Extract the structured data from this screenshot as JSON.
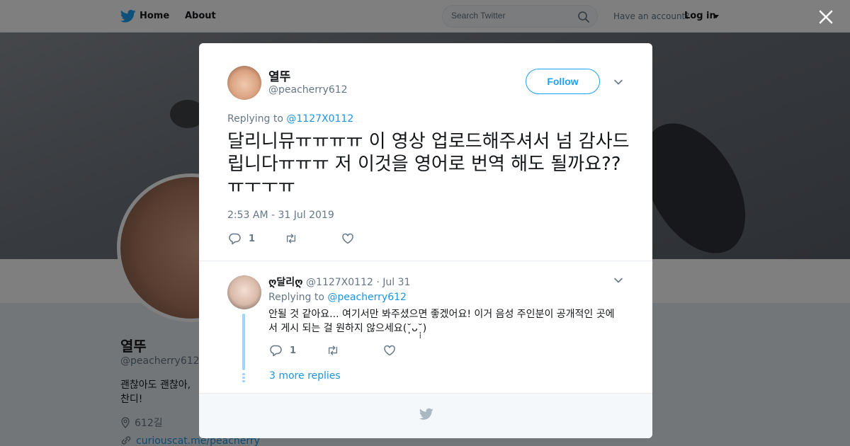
{
  "nav": {
    "home_label": "Home",
    "about_label": "About",
    "search_placeholder": "Search Twitter",
    "account_text": "Have an account?",
    "login_label": "Log in"
  },
  "profile": {
    "name": "열뚜",
    "handle": "@peacherry612",
    "bio": "괜찮아도 괜찮아, 찬디!",
    "location": "612길",
    "url": "curiouscat.me/peacherry"
  },
  "tweet": {
    "name": "열뚜",
    "handle": "@peacherry612",
    "follow_label": "Follow",
    "replying_prefix": "Replying to",
    "replying_to": "@1127X0112",
    "text": "달리니뮤ㅠㅠㅠㅠ 이 영상 업로드해주셔서 넘 감사드립니다ㅠㅠㅠ 저 이것을 영어로 번역 해도 될까요??ㅠㅜㅜㅠ",
    "timestamp": "2:53 AM - 31 Jul 2019",
    "reply_count": "1"
  },
  "reply": {
    "name": "ღ달리ღ",
    "handle": "@1127X0112",
    "date": "· Jul 31",
    "replying_prefix": "Replying to",
    "replying_to": "@peacherry612",
    "text": "안될 것 같아요... 여기서만 봐주셨으면 좋겠어요! 이거 음성 주인분이 공개적인 곳에서 게시 되는 걸 원하지 않으세요(˘̩̩̩ᴗ˘̩̩̩)",
    "reply_count": "1",
    "more_replies": "3 more replies"
  },
  "colors": {
    "accent": "#1da1f2",
    "link": "#1b95e0",
    "secondary_text": "#657786",
    "thread_line": "#a3d4f7"
  },
  "icons": [
    "twitter-bird-icon",
    "search-icon",
    "close-icon",
    "chevron-down-icon",
    "reply-icon",
    "retweet-icon",
    "like-icon",
    "location-pin-icon",
    "link-icon"
  ]
}
